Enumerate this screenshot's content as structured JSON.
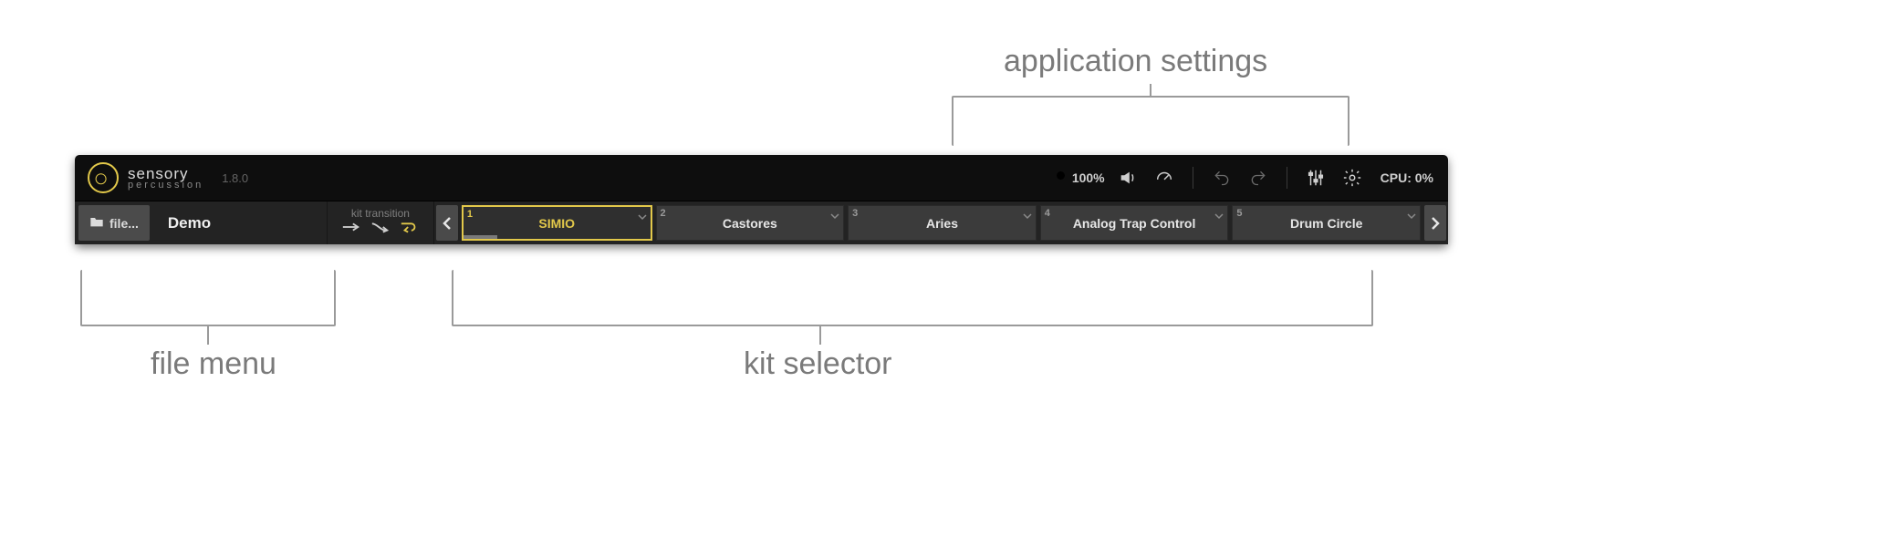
{
  "annotations": {
    "app_settings": "application settings",
    "file_menu": "file menu",
    "kit_selector": "kit selector"
  },
  "header": {
    "brand": "sensory",
    "subbrand": "percussion",
    "version": "1.8.0",
    "zoom": "100%",
    "cpu": "CPU: 0%"
  },
  "filebar": {
    "file_button": "file...",
    "set_name": "Demo",
    "kit_transition_label": "kit transition"
  },
  "kits": [
    {
      "num": "1",
      "name": "SIMIO",
      "selected": true,
      "progress_pct": 18
    },
    {
      "num": "2",
      "name": "Castores",
      "selected": false,
      "progress_pct": 0
    },
    {
      "num": "3",
      "name": "Aries",
      "selected": false,
      "progress_pct": 0
    },
    {
      "num": "4",
      "name": "Analog Trap Control",
      "selected": false,
      "progress_pct": 0
    },
    {
      "num": "5",
      "name": "Drum Circle",
      "selected": false,
      "progress_pct": 0
    }
  ],
  "colors": {
    "accent": "#e2c84a",
    "bg_dark": "#0e0e0e",
    "panel": "#3b3b3b"
  }
}
